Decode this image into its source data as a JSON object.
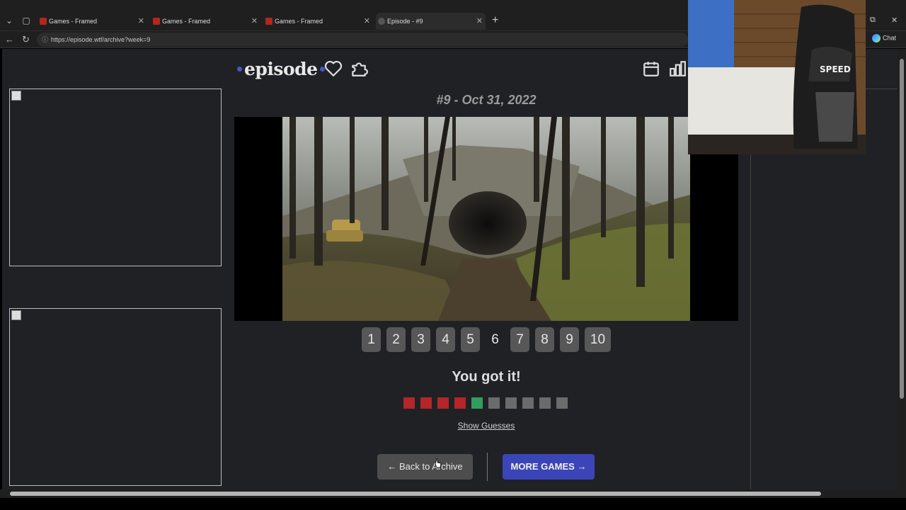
{
  "browser": {
    "tabs": [
      {
        "label": "Games - Framed"
      },
      {
        "label": "Games - Framed"
      },
      {
        "label": "Games - Framed"
      },
      {
        "label": "Episode - #9"
      }
    ],
    "url": "https://episode.wtf/archive?week=9",
    "chat_label": "Chat"
  },
  "header": {
    "brand": "episode",
    "icons": [
      "heart-icon",
      "puzzle-icon",
      "calendar-icon",
      "stats-icon"
    ]
  },
  "puzzle": {
    "title": "#9 - Oct 31, 2022",
    "guess_buttons": [
      "1",
      "2",
      "3",
      "4",
      "5",
      "6",
      "7",
      "8",
      "9",
      "10"
    ],
    "current_guess": "6",
    "result_text": "You got it!",
    "result_squares": [
      "#b3262a",
      "#b3262a",
      "#b3262a",
      "#b3262a",
      "#2f9e5f",
      "#6b6b6b",
      "#6b6b6b",
      "#6b6b6b",
      "#6b6b6b",
      "#6b6b6b"
    ],
    "show_guesses": "Show Guesses",
    "back_button": "← Back to Archive",
    "more_button": "MORE GAMES →"
  },
  "webcam": {
    "chair_text": "SPEED"
  },
  "colors": {
    "accent": "#3b45b8",
    "wrong": "#b3262a",
    "correct": "#2f9e5f",
    "unused": "#6b6b6b",
    "page_bg": "#202124"
  }
}
